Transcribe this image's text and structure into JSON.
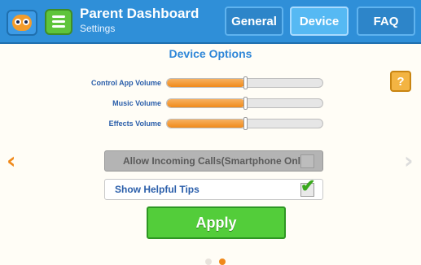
{
  "header": {
    "title": "Parent Dashboard",
    "subtitle": "Settings",
    "tabs": [
      "General",
      "Device",
      "FAQ"
    ],
    "active_tab": "Device"
  },
  "section": {
    "title": "Device Options"
  },
  "help_button": {
    "label": "?"
  },
  "sliders": [
    {
      "label": "Control App Volume",
      "level": 0.5
    },
    {
      "label": "Music Volume",
      "level": 0.5
    },
    {
      "label": "Effects Volume",
      "level": 0.5
    }
  ],
  "options": [
    {
      "label": "Allow Incoming Calls(Smartphone Only)",
      "enabled": false,
      "checked": false
    },
    {
      "label": "Show Helpful Tips",
      "enabled": true,
      "checked": true
    }
  ],
  "apply_button": {
    "label": "Apply"
  },
  "nav_arrows": {
    "prev": "‹",
    "next": "›"
  },
  "pager": {
    "pages": 2,
    "current": 2
  },
  "colors": {
    "accent_blue": "#2f8fd8",
    "orange": "#f08a1a",
    "green": "#53cd3a"
  }
}
